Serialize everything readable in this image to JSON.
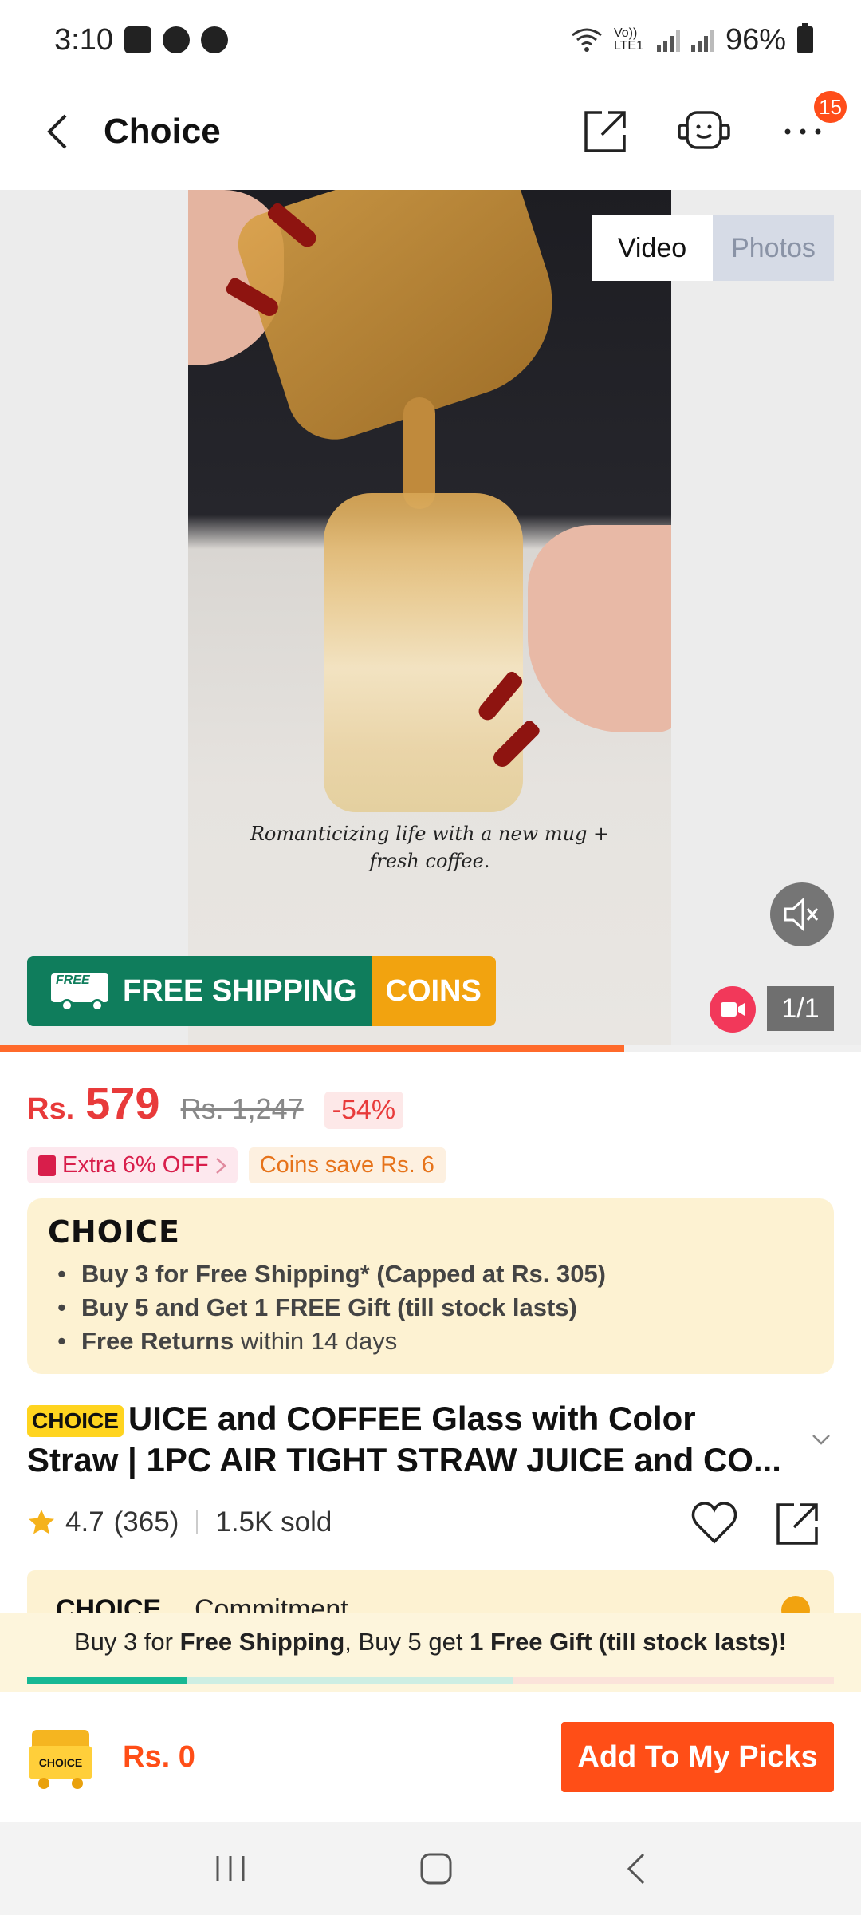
{
  "status": {
    "time": "3:10",
    "network": "Vo)) LTE1",
    "battery": "96%"
  },
  "nav": {
    "title": "Choice",
    "badge_count": "15"
  },
  "gallery": {
    "video_tab": "Video",
    "photos_tab": "Photos",
    "caption": "Romanticizing life with a new mug +\nfresh coffee.",
    "free_shipping": "FREE SHIPPING",
    "free_label": "FREE",
    "coins": "COINS",
    "counter": "1/1",
    "progress": 0.725
  },
  "price": {
    "currency": "Rs.",
    "amount": "579",
    "original": "Rs. 1,247",
    "discount": "-54%"
  },
  "promos": {
    "extra_off": "Extra 6% OFF",
    "coins_save": "Coins save Rs. 6"
  },
  "choice_box": {
    "logo": "CHOICE",
    "items": [
      {
        "bold": "Buy 3 for  Free Shipping* (Capped at Rs. 305)",
        "rest": ""
      },
      {
        "bold": "Buy 5 and Get 1 FREE Gift (till stock lasts)",
        "rest": ""
      },
      {
        "bold": "Free Returns",
        "rest": " within 14 days"
      }
    ]
  },
  "product": {
    "tag": "CHOICE",
    "title": "UICE and COFFEE Glass with Color Straw | 1PC AIR TIGHT STRAW JUICE and CO...",
    "rating": "4.7",
    "reviews": "(365)",
    "sold": "1.5K sold"
  },
  "commitment": {
    "logo": "CHOICE",
    "label": "Commitment"
  },
  "ship_banner": {
    "p1": "Buy 3 for ",
    "b1": "Free Shipping",
    "p2": ", Buy 5 get ",
    "b2": "1 Free Gift (till stock lasts)!"
  },
  "bottom": {
    "cart_label": "CHOICE",
    "picks_price": "Rs. 0",
    "add_button": "Add To My Picks"
  },
  "colors": {
    "accent": "#ff4e17",
    "price": "#e83a3a",
    "choice_bg": "#fdf2d2",
    "shipping_green": "#0f7d5c",
    "coins_orange": "#f2a30f"
  }
}
